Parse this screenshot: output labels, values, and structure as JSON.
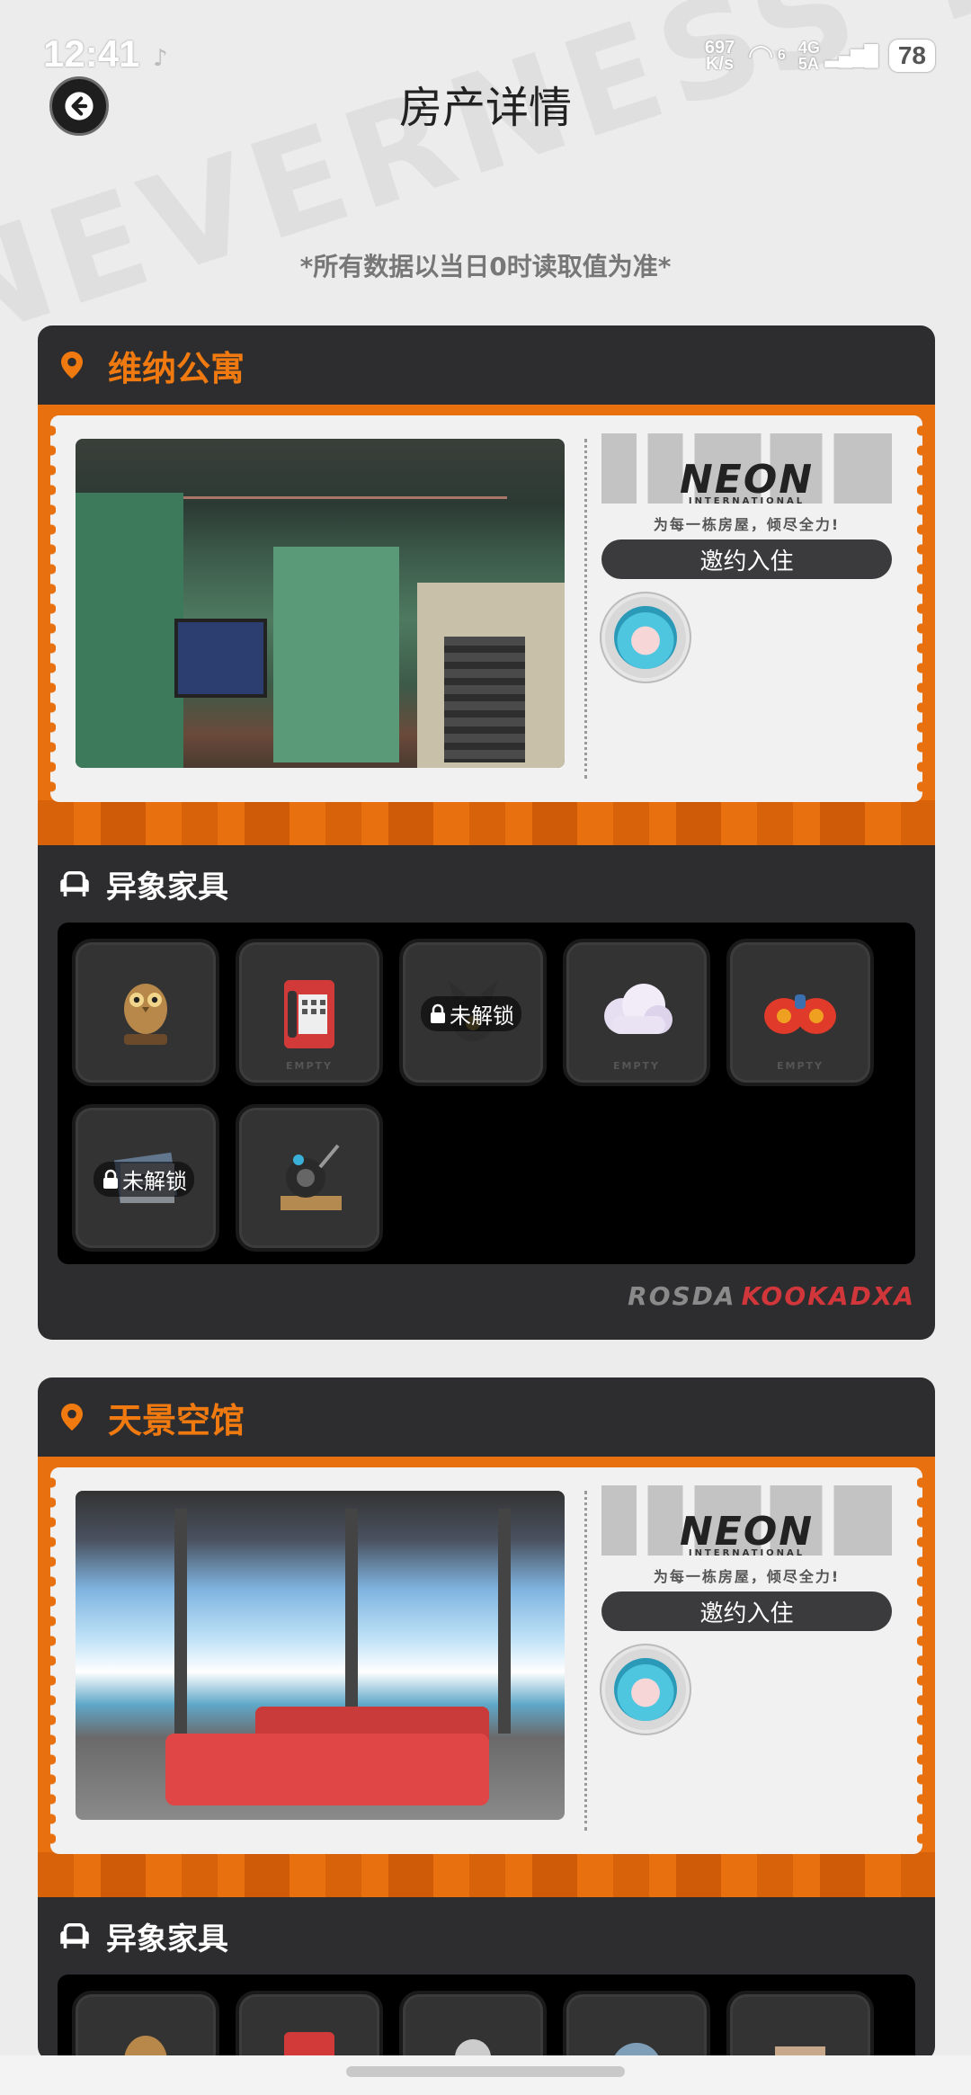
{
  "status_bar": {
    "time": "12:41",
    "net_speed_value": "697",
    "net_speed_unit": "K/s",
    "signal_1": "4G",
    "signal_2": "5A",
    "wifi_badge": "6",
    "battery": "78"
  },
  "header": {
    "title": "房产详情"
  },
  "notice": "*所有数据以当日0时读取值为准*",
  "properties": [
    {
      "name": "维纳公寓",
      "logo_text": "NEON",
      "logo_sub": "INTERNATIONAL",
      "slogan": "为每一栋房屋，倾尽全力!",
      "invite_label": "邀约入住",
      "furniture_title": "异象家具",
      "furniture": [
        {
          "icon": "owl-statue-icon",
          "locked": false
        },
        {
          "icon": "red-payphone-icon",
          "locked": false,
          "tag": "EMPTY"
        },
        {
          "icon": "bangboo-figure-icon",
          "locked": true
        },
        {
          "icon": "cloud-cushion-icon",
          "locked": false,
          "tag": "EMPTY"
        },
        {
          "icon": "red-boxing-gloves-icon",
          "locked": false,
          "tag": "EMPTY"
        },
        {
          "icon": "newspaper-stack-icon",
          "locked": true
        },
        {
          "icon": "motorcycle-engine-icon",
          "locked": false
        }
      ],
      "lock_label": "未解锁",
      "brand_left": "ROSDA",
      "brand_right": "KOOKADXA"
    },
    {
      "name": "天景空馆",
      "logo_text": "NEON",
      "logo_sub": "INTERNATIONAL",
      "slogan": "为每一栋房屋，倾尽全力!",
      "invite_label": "邀约入住",
      "furniture_title": "异象家具"
    }
  ],
  "colors": {
    "accent": "#f07a10",
    "card_bg": "#2d2d2f",
    "ticket_border": "#e8700f",
    "lock_brand": "#d0363a"
  }
}
